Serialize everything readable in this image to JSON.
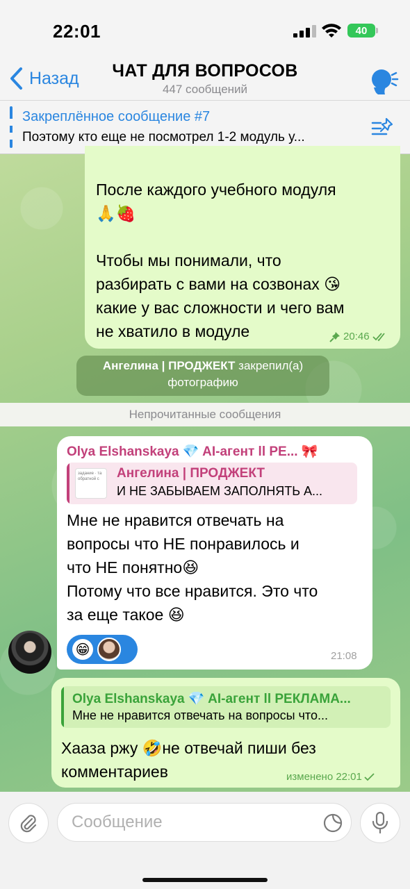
{
  "status": {
    "time": "22:01",
    "battery": "40"
  },
  "header": {
    "back_label": "Назад",
    "title": "ЧАТ ДЛЯ ВОПРОСОВ",
    "subtitle": "447 сообщений"
  },
  "pinned": {
    "title": "Закреплённое сообщение #7",
    "text": "Поэтому кто еще не посмотрел 1-2 модуль у..."
  },
  "messages": {
    "own_top": {
      "line1": "После каждого учебного модуля",
      "line2": "🙏🍓",
      "line3": "Чтобы мы понимали, что",
      "line4": "разбирать с вами на созвонах 😘",
      "line5": "какие у вас сложности и чего вам",
      "line6": "не хватило в модуле",
      "time": "20:46"
    },
    "system": {
      "author": "Ангелина | ПРОДЖЕКТ",
      "action": " закрепил(а)",
      "object": "фотографию"
    },
    "unread_label": "Непрочитанные сообщения",
    "incoming": {
      "sender": "Olya Elshanskaya 💎 AI-агент ll PE... 🎀",
      "reply_author": "Ангелина | ПРОДЖЕКТ",
      "reply_text": "И НЕ ЗАБЫВАЕМ ЗАПОЛНЯТЬ А...",
      "reply_thumb_text": "задание · та обратной с",
      "line1": "Мне не нравится отвечать на",
      "line2": "вопросы что НЕ понравилось и",
      "line3": "что НЕ понятно😆",
      "line4": "Потому что все нравится. Это что",
      "line5": "за еще такое 😆",
      "reaction_emoji": "😁",
      "time": "21:08"
    },
    "own_bottom": {
      "reply_author": "Olya Elshanskaya 💎 AI-агент ll РЕКЛАМА...",
      "reply_text": "Мне не нравится отвечать на вопросы что...",
      "line1": "Хааза ржу 🤣не отвечай пиши без",
      "line2": "комментариев",
      "edited_time": "изменено 22:01"
    }
  },
  "composer": {
    "placeholder": "Сообщение"
  },
  "colors": {
    "accent": "#2a86e0",
    "outgoing": "#e4fbc9",
    "sender_name": "#c2407a",
    "reply_green": "#3aa33a"
  }
}
